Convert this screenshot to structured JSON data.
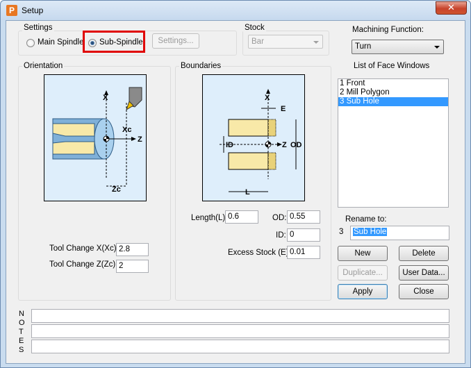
{
  "window": {
    "title": "Setup",
    "app_icon_letter": "P",
    "close_glyph": "✕"
  },
  "settings": {
    "group_title": "Settings",
    "main_spindle_label": "Main Spindle",
    "sub_spindle_label": "Sub-Spindle",
    "selected": "Sub-Spindle",
    "settings_button": "Settings..."
  },
  "stock": {
    "group_title": "Stock",
    "value": "Bar"
  },
  "machining_function": {
    "label": "Machining Function:",
    "value": "Turn"
  },
  "face_windows": {
    "label": "List of Face Windows",
    "items": [
      "1 Front",
      "2 Mill Polygon",
      "3 Sub Hole"
    ],
    "selected_index": 2
  },
  "rename": {
    "label": "Rename to:",
    "number": "3",
    "value": "Sub Hole"
  },
  "buttons": {
    "new": "New",
    "delete": "Delete",
    "duplicate": "Duplicate...",
    "user_data": "User Data...",
    "apply": "Apply",
    "close": "Close"
  },
  "orientation": {
    "group_title": "Orientation",
    "diagram_labels": {
      "x": "X",
      "xc": "Xc",
      "z": "Z",
      "zc": "Zc"
    },
    "tool_change_x_label": "Tool Change X(Xc):",
    "tool_change_x_value": "2.8",
    "tool_change_z_label": "Tool Change Z(Zc):",
    "tool_change_z_value": "2"
  },
  "boundaries": {
    "group_title": "Boundaries",
    "diagram_labels": {
      "x": "X",
      "e": "E",
      "id": "ID",
      "z": "Z",
      "od": "OD",
      "l": "L"
    },
    "length_label": "Length(L):",
    "length_value": "0.6",
    "od_label": "OD:",
    "od_value": "0.55",
    "id_label": "ID:",
    "id_value": "0",
    "excess_label": "Excess Stock (E):",
    "excess_value": "0.01"
  },
  "notes": {
    "letters": [
      "N",
      "O",
      "T",
      "E",
      "S"
    ]
  },
  "colors": {
    "highlight": "#e00000",
    "selection": "#3399ff",
    "diagram_bg": "#deeefb",
    "part_fill": "#f8e9a8"
  }
}
